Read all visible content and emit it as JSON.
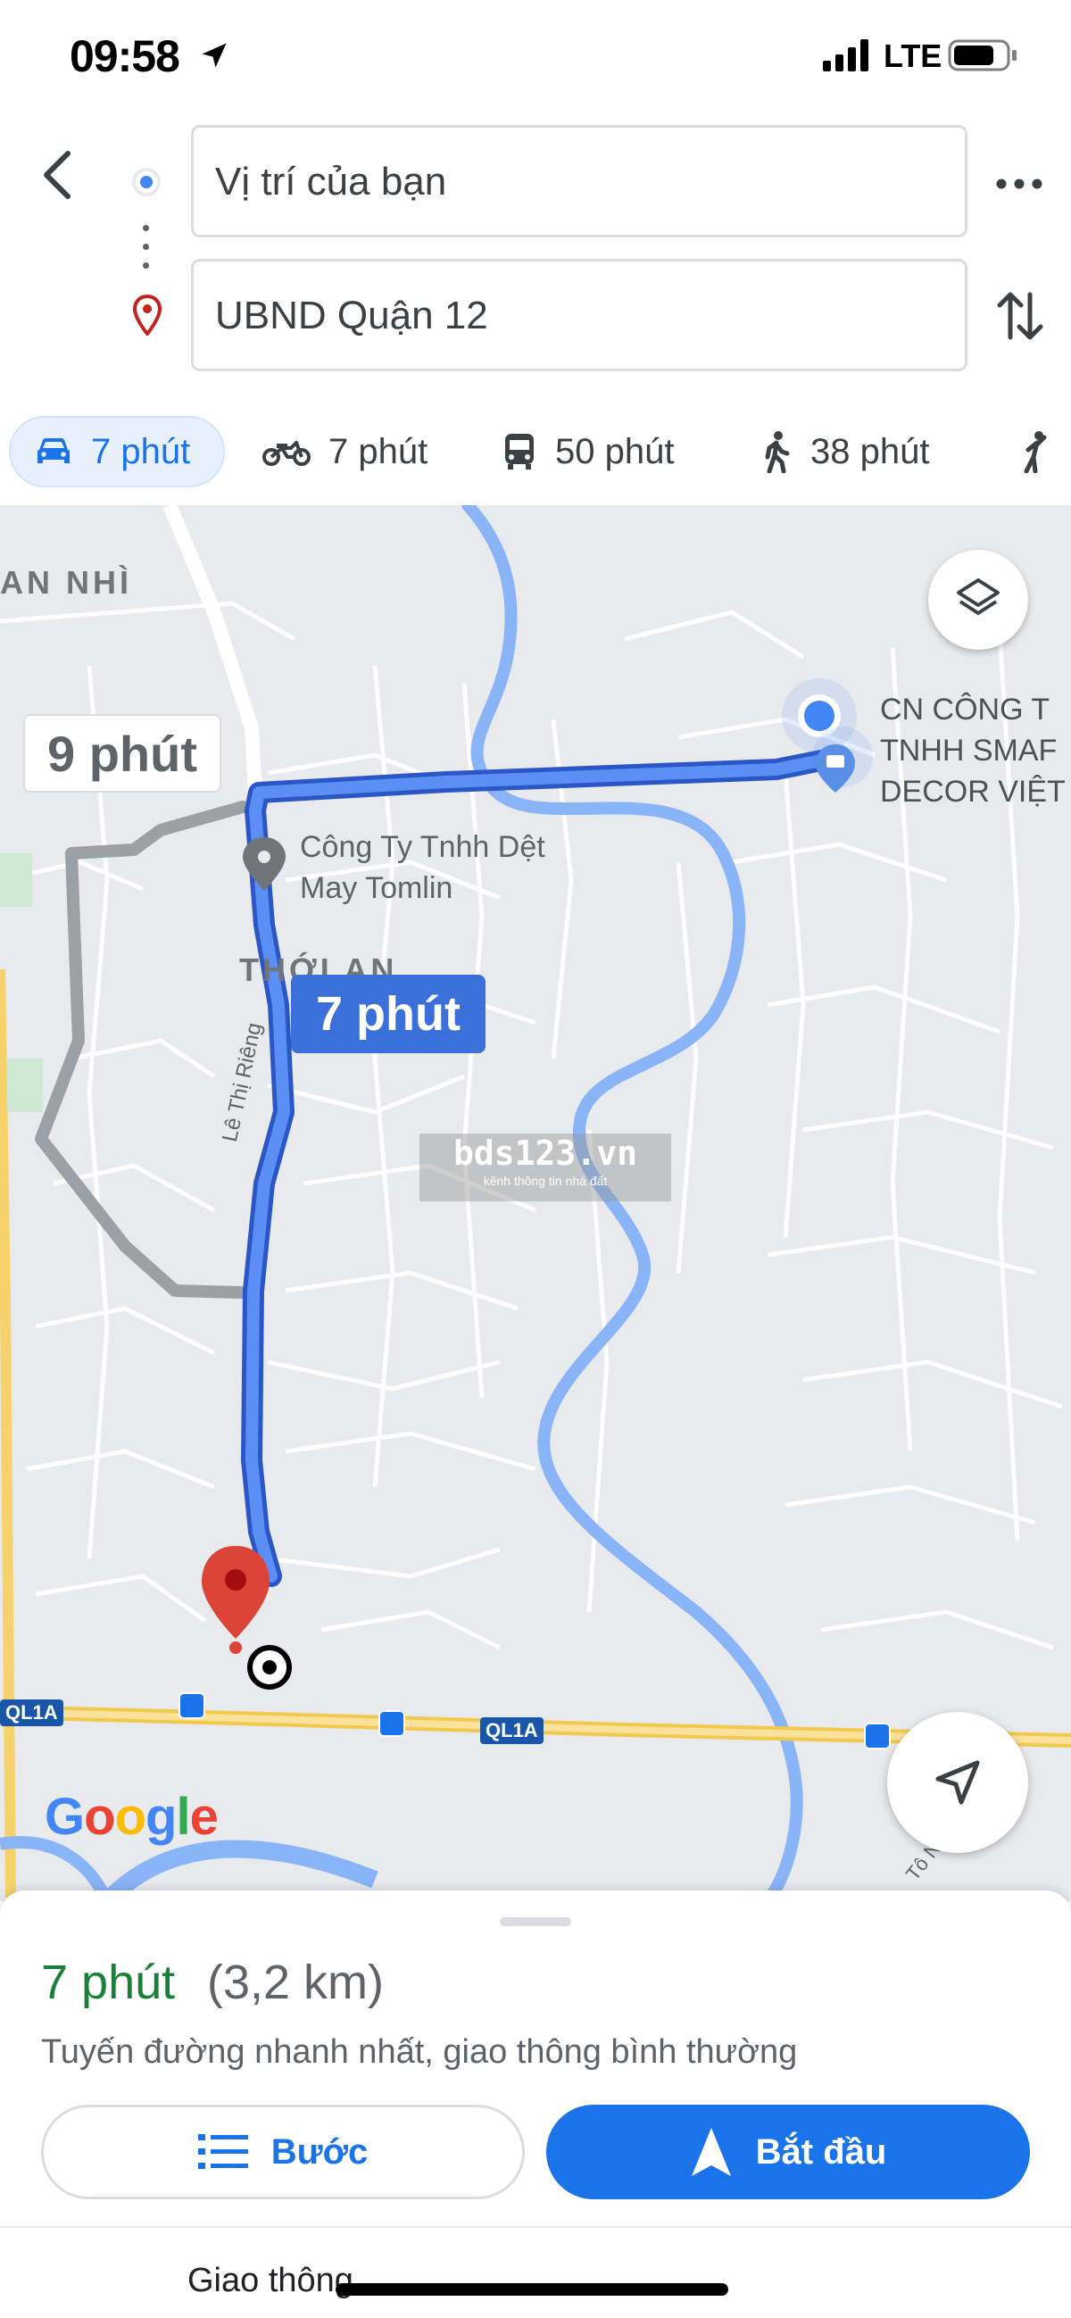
{
  "status_bar": {
    "time": "09:58",
    "carrier": "LTE"
  },
  "directions": {
    "origin_value": "Vị trí của bạn",
    "destination_value": "UBND Quận 12"
  },
  "modes": [
    {
      "name": "car",
      "label": "7 phút",
      "selected": true
    },
    {
      "name": "motorbike",
      "label": "7 phút",
      "selected": false
    },
    {
      "name": "transit",
      "label": "50 phút",
      "selected": false
    },
    {
      "name": "walk",
      "label": "38 phút",
      "selected": false
    },
    {
      "name": "cycle",
      "label": "",
      "selected": false
    }
  ],
  "map": {
    "selected_route_time": "7 phút",
    "alt_route_time": "9 phút",
    "poi_tomlin": [
      "Công Ty Tnhh Dệt",
      "May Tomlin"
    ],
    "poi_smart": [
      "CN CÔNG T",
      "TNHH SMAF",
      "DECOR VIỆT"
    ],
    "area_annhi": "AN NHÌ",
    "area_thoian": "THỚI AN",
    "street_le_thi_rieng": "Lê Thị Riêng",
    "street_to_ngoc_van": "Tô Ngọc Vân",
    "highway_label": "QL1A",
    "watermark_main": "bds123.vn",
    "watermark_sub": "kênh thông tin nhà đất",
    "google_logo": [
      "G",
      "o",
      "o",
      "g",
      "l",
      "e"
    ],
    "colors": {
      "route_selected": "#4a80f0",
      "route_alt": "#9aa0a6",
      "river": "#8ab4f8",
      "highway": "#f4d56b",
      "destination_pin": "#db4437"
    }
  },
  "sheet": {
    "eta_time": "7 phút",
    "eta_distance": "(3,2 km)",
    "route_description": "Tuyến đường nhanh nhất, giao thông bình thường",
    "steps_label": "Bước",
    "start_label": "Bắt đầu",
    "traffic_label": "Giao thông"
  }
}
